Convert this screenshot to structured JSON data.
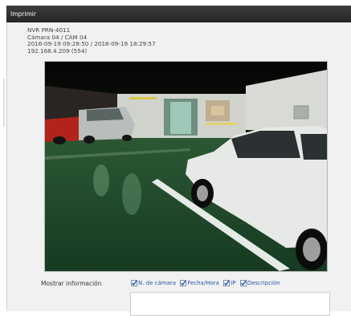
{
  "window": {
    "title": "Imprimir"
  },
  "info": {
    "device": "NVR PRN-4011",
    "camera": "Cámara 04 / CAM 04",
    "timerange": "2016-09-19 09:28:50 / 2016-09-19 18:29:57",
    "address": "192.168.4.209 (554)"
  },
  "options": {
    "label": "Mostrar información",
    "checkboxes": [
      {
        "label": "N. de cámara",
        "checked": true
      },
      {
        "label": "Fecha/Hora",
        "checked": true
      },
      {
        "label": "IP",
        "checked": true
      },
      {
        "label": "Descripción",
        "checked": true
      }
    ]
  },
  "colors": {
    "titlebar": "#2f2f2f",
    "checkbox": "#2a58a6",
    "floor": "#1f4a2c"
  }
}
